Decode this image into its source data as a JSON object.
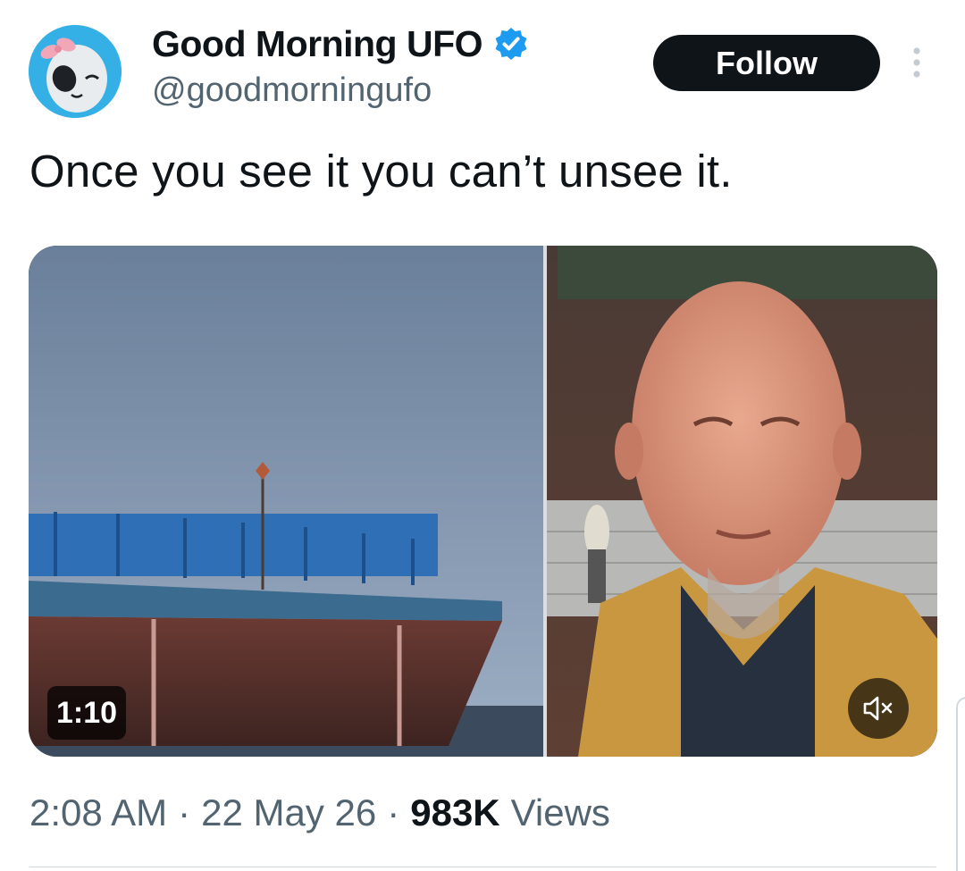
{
  "author": {
    "display_name": "Good Morning UFO",
    "handle": "@goodmorningufo",
    "verified_icon": "verified-badge-icon",
    "avatar_icon": "alien-with-bow-avatar"
  },
  "actions": {
    "follow_label": "Follow",
    "more_icon": "more-vertical-icon"
  },
  "tweet": {
    "text": "Once you see it you can’t unsee it."
  },
  "media": {
    "type": "video",
    "duration": "1:10",
    "mute_icon": "volume-muted-icon"
  },
  "meta": {
    "time": "2:08 AM",
    "separator": "·",
    "date": "22 May 26",
    "views_count": "983K",
    "views_label": "Views"
  },
  "colors": {
    "text_primary": "#0f1419",
    "text_secondary": "#536471",
    "verified_blue": "#1d9bf0",
    "follow_bg": "#0f1419",
    "divider": "#cfd9de"
  }
}
